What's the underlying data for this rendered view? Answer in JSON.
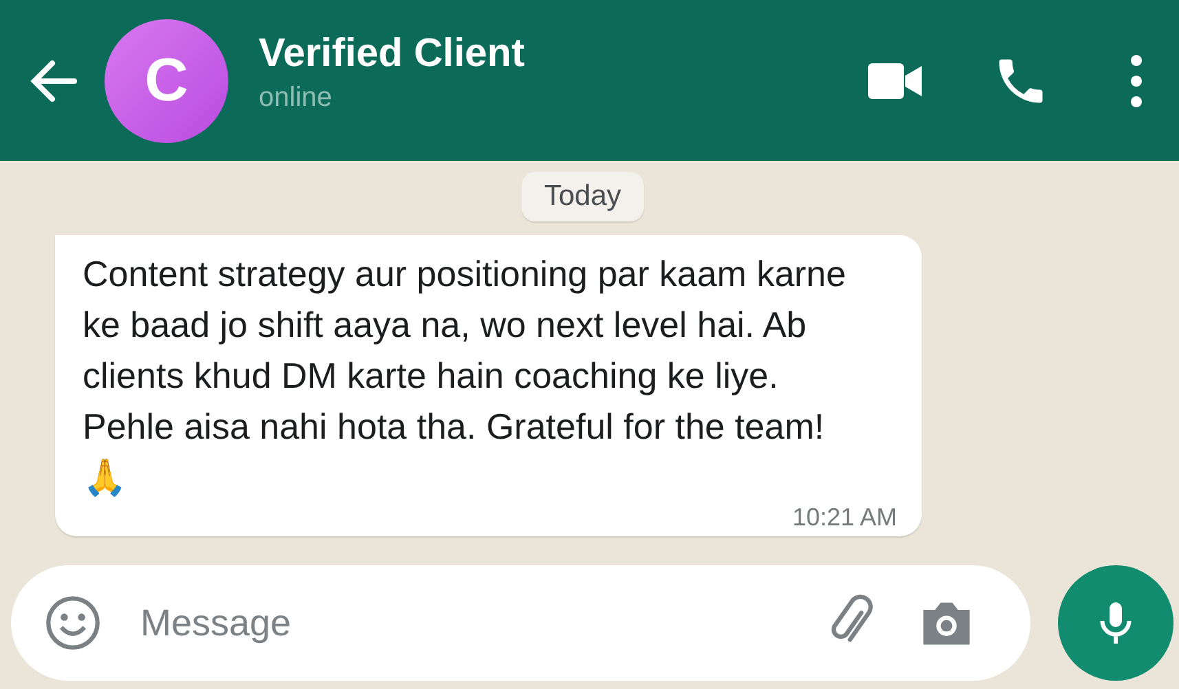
{
  "header": {
    "avatar_letter": "C",
    "title": "Verified Client",
    "status": "online"
  },
  "date_chip": "Today",
  "messages": [
    {
      "text": "Content strategy aur positioning par kaam karne ke baad jo shift aaya na, wo next level hai. Ab clients khud DM karte hain coaching ke liye. Pehle aisa nahi hota tha. Grateful for the team! 🙏",
      "time": "10:21 AM"
    }
  ],
  "composer": {
    "placeholder": "Message"
  }
}
